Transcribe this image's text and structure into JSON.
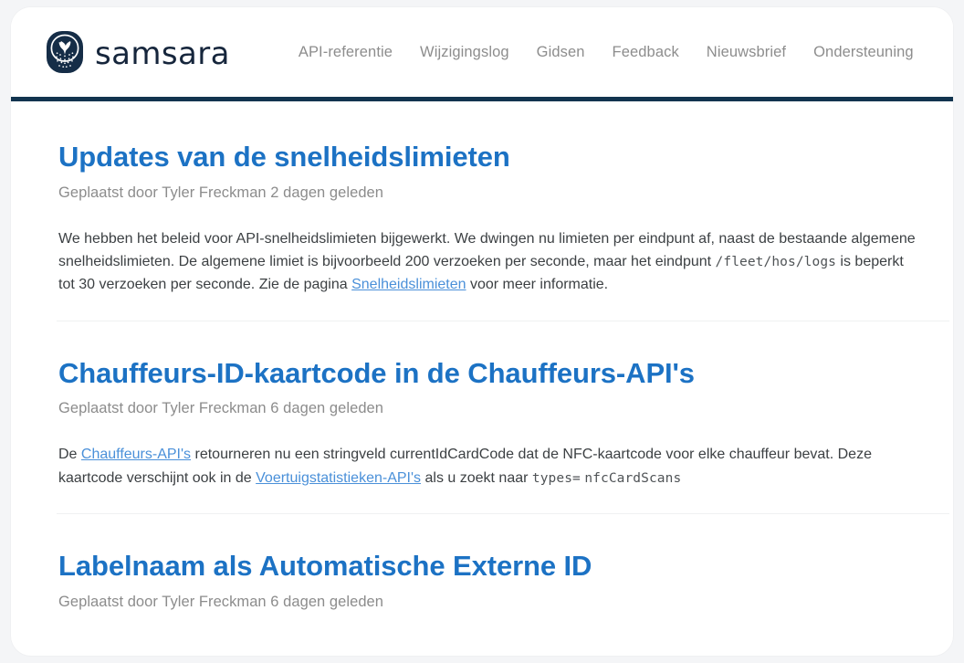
{
  "header": {
    "logo_icon": "samsara-owl-icon",
    "brand_name": "samsara",
    "accent_rule_color": "#12344f",
    "nav": [
      {
        "label": "API-referentie"
      },
      {
        "label": "Wijzigingslog"
      },
      {
        "label": "Gidsen"
      },
      {
        "label": "Feedback"
      },
      {
        "label": "Nieuwsbrief"
      },
      {
        "label": "Ondersteuning"
      }
    ]
  },
  "colors": {
    "heading_blue": "#1c72c4",
    "link_blue": "#4a90d9",
    "meta_gray": "#8c8c8c",
    "body_gray": "#3c4043",
    "rule_navy": "#12344f",
    "page_bg": "#f4f5f7"
  },
  "posts": [
    {
      "title": "Updates van de snelheidslimieten",
      "meta": "Geplaatst door Tyler Freckman 2 dagen geleden",
      "body": {
        "part1": "We hebben het beleid voor API-snelheidslimieten bijgewerkt. We dwingen nu limieten per eindpunt af, naast de bestaande algemene snelheidslimieten. De algemene limiet is bijvoorbeeld 200 verzoeken per seconde, maar het eindpunt ",
        "code1": "/fleet/hos/logs",
        "part2": " is beperkt tot 30 verzoeken per seconde. Zie de pagina ",
        "link1": "Snelheidslimieten",
        "part3": " voor meer informatie."
      }
    },
    {
      "title": "Chauffeurs-ID-kaartcode in de Chauffeurs-API's",
      "meta": "Geplaatst door Tyler Freckman 6 dagen geleden",
      "body": {
        "part1": "De ",
        "link1": "Chauffeurs-API's",
        "part2": " retourneren nu een stringveld currentIdCardCode dat de NFC-kaartcode voor elke chauffeur bevat. Deze kaartcode verschijnt ook in de ",
        "link2": "Voertuigstatistieken-API's",
        "part3": " als u zoekt naar ",
        "code1": "types=",
        "code2": "nfcCardScans"
      }
    },
    {
      "title": "Labelnaam als Automatische Externe ID",
      "meta": "Geplaatst door Tyler Freckman 6 dagen geleden"
    }
  ]
}
